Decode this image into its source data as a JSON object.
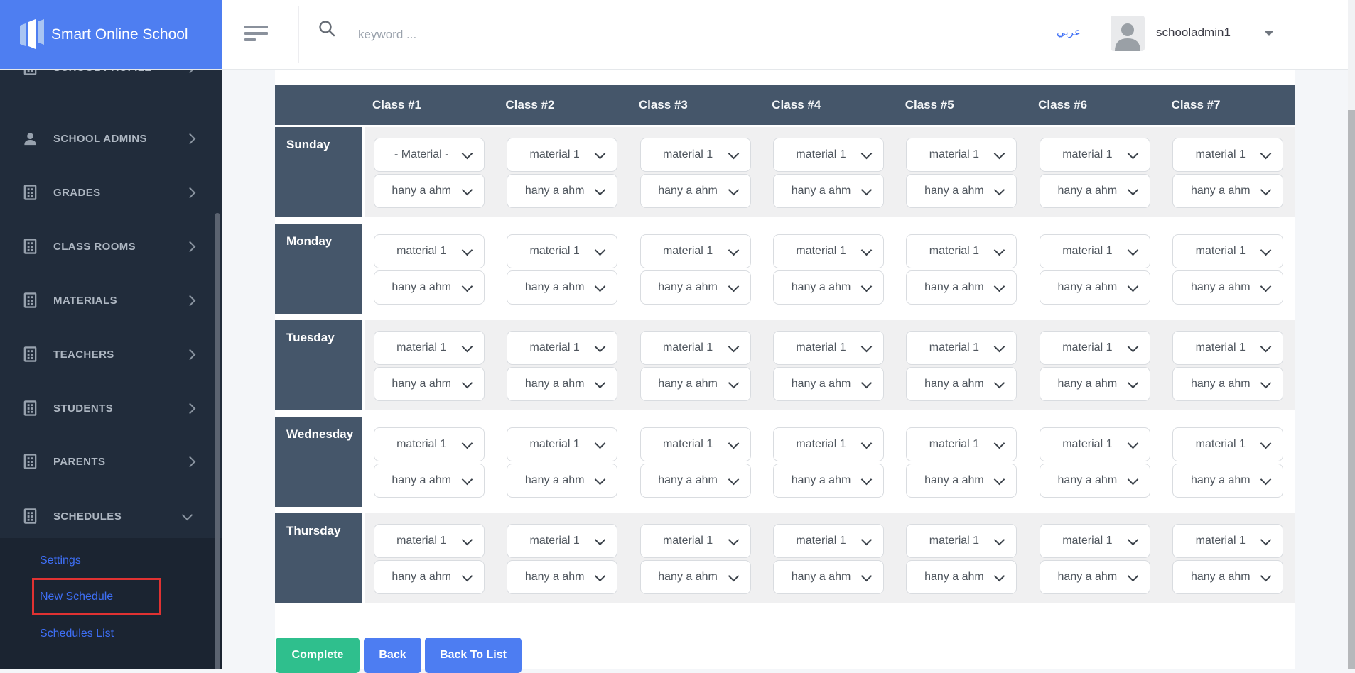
{
  "header": {
    "brand": "Smart Online School",
    "search_placeholder": "keyword ...",
    "language_link": "عربي",
    "username": "schooladmin1"
  },
  "sidebar": {
    "items": [
      {
        "id": "school-profile",
        "label": "SCHOOL PROFILE",
        "icon": "building-icon",
        "chevron": "right"
      },
      {
        "id": "school-admins",
        "label": "SCHOOL ADMINS",
        "icon": "person-icon",
        "chevron": "right"
      },
      {
        "id": "grades",
        "label": "GRADES",
        "icon": "building-icon",
        "chevron": "right"
      },
      {
        "id": "class-rooms",
        "label": "CLASS ROOMS",
        "icon": "building-icon",
        "chevron": "right"
      },
      {
        "id": "materials",
        "label": "MATERIALS",
        "icon": "building-icon",
        "chevron": "right"
      },
      {
        "id": "teachers",
        "label": "TEACHERS",
        "icon": "building-icon",
        "chevron": "right"
      },
      {
        "id": "students",
        "label": "STUDENTS",
        "icon": "building-icon",
        "chevron": "right"
      },
      {
        "id": "parents",
        "label": "PARENTS",
        "icon": "building-icon",
        "chevron": "right"
      },
      {
        "id": "schedules",
        "label": "SCHEDULES",
        "icon": "building-icon",
        "chevron": "down",
        "expanded": true
      }
    ],
    "submenu": [
      {
        "id": "settings",
        "label": "Settings",
        "highlighted": false
      },
      {
        "id": "new-schedule",
        "label": "New Schedule",
        "highlighted": true
      },
      {
        "id": "schedules-list",
        "label": "Schedules List",
        "highlighted": false
      }
    ]
  },
  "schedule": {
    "columns": [
      "Class #1",
      "Class #2",
      "Class #3",
      "Class #4",
      "Class #5",
      "Class #6",
      "Class #7"
    ],
    "days": [
      "Sunday",
      "Monday",
      "Tuesday",
      "Wednesday",
      "Thursday"
    ],
    "cells": [
      [
        {
          "material": "- Material -",
          "teacher": "hany a ahm"
        },
        {
          "material": "material 1",
          "teacher": "hany a ahm"
        },
        {
          "material": "material 1",
          "teacher": "hany a ahm"
        },
        {
          "material": "material 1",
          "teacher": "hany a ahm"
        },
        {
          "material": "material 1",
          "teacher": "hany a ahm"
        },
        {
          "material": "material 1",
          "teacher": "hany a ahm"
        },
        {
          "material": "material 1",
          "teacher": "hany a ahm"
        }
      ],
      [
        {
          "material": "material 1",
          "teacher": "hany a ahm"
        },
        {
          "material": "material 1",
          "teacher": "hany a ahm"
        },
        {
          "material": "material 1",
          "teacher": "hany a ahm"
        },
        {
          "material": "material 1",
          "teacher": "hany a ahm"
        },
        {
          "material": "material 1",
          "teacher": "hany a ahm"
        },
        {
          "material": "material 1",
          "teacher": "hany a ahm"
        },
        {
          "material": "material 1",
          "teacher": "hany a ahm"
        }
      ],
      [
        {
          "material": "material 1",
          "teacher": "hany a ahm"
        },
        {
          "material": "material 1",
          "teacher": "hany a ahm"
        },
        {
          "material": "material 1",
          "teacher": "hany a ahm"
        },
        {
          "material": "material 1",
          "teacher": "hany a ahm"
        },
        {
          "material": "material 1",
          "teacher": "hany a ahm"
        },
        {
          "material": "material 1",
          "teacher": "hany a ahm"
        },
        {
          "material": "material 1",
          "teacher": "hany a ahm"
        }
      ],
      [
        {
          "material": "material 1",
          "teacher": "hany a ahm"
        },
        {
          "material": "material 1",
          "teacher": "hany a ahm"
        },
        {
          "material": "material 1",
          "teacher": "hany a ahm"
        },
        {
          "material": "material 1",
          "teacher": "hany a ahm"
        },
        {
          "material": "material 1",
          "teacher": "hany a ahm"
        },
        {
          "material": "material 1",
          "teacher": "hany a ahm"
        },
        {
          "material": "material 1",
          "teacher": "hany a ahm"
        }
      ],
      [
        {
          "material": "material 1",
          "teacher": "hany a ahm"
        },
        {
          "material": "material 1",
          "teacher": "hany a ahm"
        },
        {
          "material": "material 1",
          "teacher": "hany a ahm"
        },
        {
          "material": "material 1",
          "teacher": "hany a ahm"
        },
        {
          "material": "material 1",
          "teacher": "hany a ahm"
        },
        {
          "material": "material 1",
          "teacher": "hany a ahm"
        },
        {
          "material": "material 1",
          "teacher": "hany a ahm"
        }
      ]
    ]
  },
  "actions": [
    {
      "id": "complete",
      "label": "Complete",
      "color": "#2fbf8d"
    },
    {
      "id": "back",
      "label": "Back",
      "color": "#4d7df2"
    },
    {
      "id": "back-to-list",
      "label": "Back To List",
      "color": "#4d7df2"
    }
  ],
  "colors": {
    "brand_blue": "#4e7ef1",
    "sidebar_dark": "#212c3b",
    "submenu_dark": "#1b2431",
    "table_slate": "#45566a",
    "row_alt_gray": "#f0f0f1",
    "link_blue": "#3e6ff6",
    "highlight_red": "#e03232",
    "button_green": "#2fbf8d",
    "button_blue": "#4d7df2"
  }
}
